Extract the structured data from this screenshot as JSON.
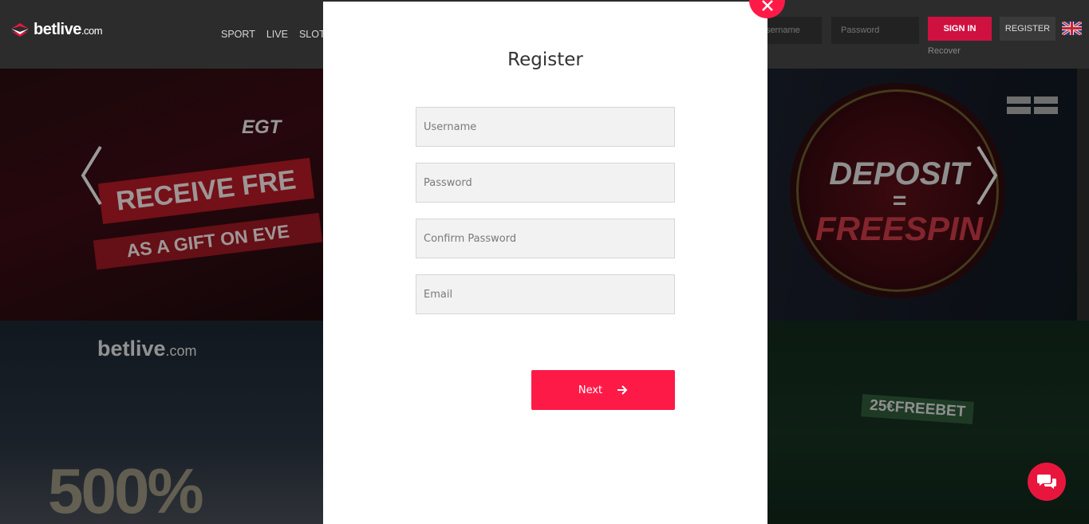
{
  "header": {
    "logo_text": "betlive",
    "logo_suffix": ".com",
    "nav": [
      "SPORT",
      "LIVE",
      "SLOTS"
    ],
    "username_placeholder": "Username",
    "password_placeholder": "Password",
    "signin_label": "SIGN IN",
    "register_label": "REGISTER",
    "recover_label": "Recover",
    "language": "English"
  },
  "banners": {
    "egt_logo": "EGT",
    "egt_line1": "RECEIVE FRE",
    "egt_line2": "AS A GIFT ON EVE",
    "xmas_logo": "betlive",
    "xmas_logo_suffix": ".com",
    "xmas_promo": "500%",
    "deposit_line1": "DEPOSIT",
    "deposit_eq": "=",
    "deposit_line2": "FREESPIN",
    "freebet": "25€FREEBET"
  },
  "modal": {
    "title": "Register",
    "fields": {
      "username": "Username",
      "password": "Password",
      "confirm_password": "Confirm Password",
      "email": "Email"
    },
    "next_label": "Next"
  },
  "colors": {
    "accent": "#fe1a47",
    "signin": "#cf1140",
    "header_bg": "#2c2c2c"
  }
}
